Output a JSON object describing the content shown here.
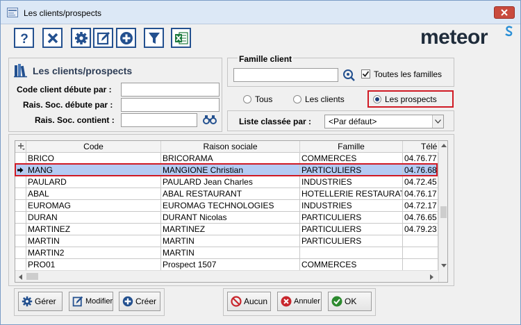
{
  "window": {
    "title": "Les clients/prospects"
  },
  "toolbar": [
    {
      "name": "help-icon",
      "glyph": "?"
    },
    {
      "name": "delete-icon",
      "glyph": "X"
    },
    {
      "name": "gear-icon",
      "glyph": ""
    },
    {
      "name": "edit-icon",
      "glyph": ""
    },
    {
      "name": "add-icon",
      "glyph": ""
    },
    {
      "name": "filter-icon",
      "glyph": ""
    },
    {
      "name": "excel-icon",
      "glyph": ""
    }
  ],
  "logo": "meteor",
  "search_panel": {
    "title": "Les clients/prospects",
    "code_label": "Code client débute par :",
    "rais_label": "Rais. Soc. débute par :",
    "contient_label": "Rais. Soc. contient :",
    "code_value": "",
    "rais_value": "",
    "contient_value": ""
  },
  "famille": {
    "label": "Famille client",
    "value": "",
    "toutes_label": "Toutes les familles",
    "toutes_checked": true
  },
  "type_filter": {
    "options": [
      "Tous",
      "Les clients",
      "Les prospects"
    ],
    "selected": "Les prospects"
  },
  "sort": {
    "label": "Liste classée par :",
    "value": "<Par défaut>"
  },
  "table": {
    "columns": [
      "Code",
      "Raison sociale",
      "Famille",
      "Télé"
    ],
    "selected_row": 1,
    "rows": [
      [
        "BRICO",
        "BRICORAMA",
        "COMMERCES",
        "04.76.77"
      ],
      [
        "MANG",
        "MANGIONE Christian",
        "PARTICULIERS",
        "04.76.68"
      ],
      [
        "PAULARD",
        "PAULARD Jean Charles",
        "INDUSTRIES",
        "04.72.45"
      ],
      [
        "ABAL",
        "ABAL RESTAURANT",
        "HOTELLERIE RESTAURATION",
        "04.76.17"
      ],
      [
        "EUROMAG",
        "EUROMAG TECHNOLOGIES",
        "INDUSTRIES",
        "04.72.17"
      ],
      [
        "DURAN",
        "DURANT Nicolas",
        "PARTICULIERS",
        "04.76.65"
      ],
      [
        "MARTINEZ",
        "MARTINEZ",
        "PARTICULIERS",
        "04.79.23"
      ],
      [
        "MARTIN",
        "MARTIN",
        "PARTICULIERS",
        ""
      ],
      [
        "MARTIN2",
        "MARTIN",
        "",
        ""
      ],
      [
        "PRO01",
        "Prospect 1507",
        "COMMERCES",
        ""
      ]
    ]
  },
  "buttons": {
    "gerer": "Gérer",
    "modifier": "Modifier",
    "creer": "Créer",
    "aucun": "Aucun",
    "annuler": "Annuler",
    "ok": "OK"
  },
  "colors": {
    "accent": "#23508f",
    "highlight": "#d01a24",
    "selection": "#b4cbf3"
  }
}
